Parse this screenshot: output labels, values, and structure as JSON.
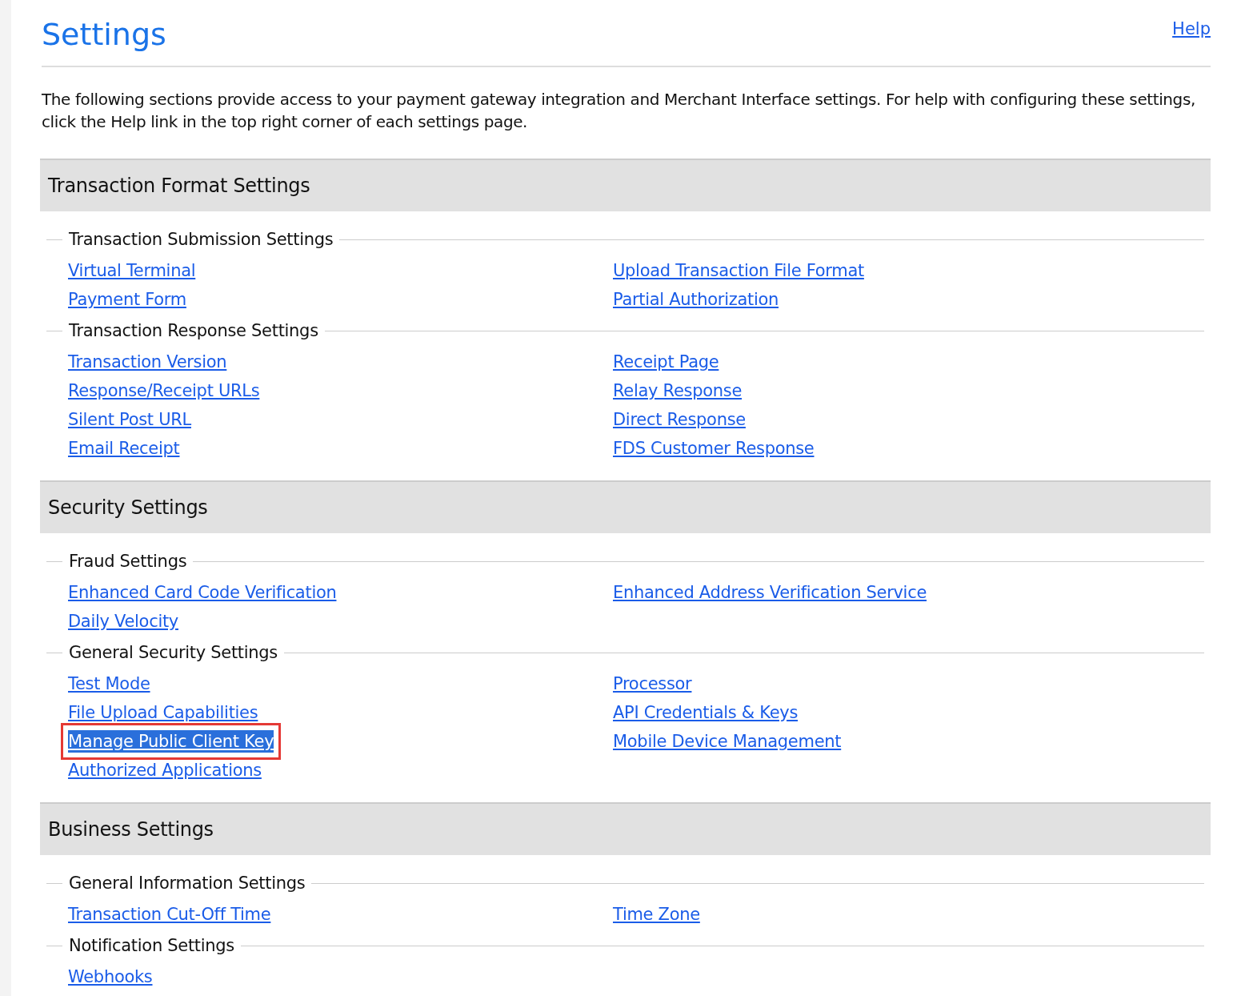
{
  "title": "Settings",
  "help_link": "Help",
  "intro": "The following sections provide access to your payment gateway integration and Merchant Interface settings. For help with configuring these settings, click the Help link in the top right corner of each settings page.",
  "sections": [
    {
      "title": "Transaction Format Settings",
      "groups": [
        {
          "title": "Transaction Submission Settings",
          "left": [
            {
              "label": "Virtual Terminal",
              "selected": false
            },
            {
              "label": "Payment Form",
              "selected": false
            }
          ],
          "right": [
            {
              "label": "Upload Transaction File Format",
              "selected": false
            },
            {
              "label": "Partial Authorization",
              "selected": false
            }
          ]
        },
        {
          "title": "Transaction Response Settings",
          "left": [
            {
              "label": "Transaction Version",
              "selected": false
            },
            {
              "label": "Response/Receipt URLs",
              "selected": false
            },
            {
              "label": "Silent Post URL",
              "selected": false
            },
            {
              "label": "Email Receipt",
              "selected": false
            }
          ],
          "right": [
            {
              "label": "Receipt Page",
              "selected": false
            },
            {
              "label": "Relay Response",
              "selected": false
            },
            {
              "label": "Direct Response",
              "selected": false
            },
            {
              "label": "FDS Customer Response",
              "selected": false
            }
          ]
        }
      ]
    },
    {
      "title": "Security Settings",
      "groups": [
        {
          "title": "Fraud Settings",
          "left": [
            {
              "label": "Enhanced Card Code Verification",
              "selected": false
            },
            {
              "label": "Daily Velocity",
              "selected": false
            }
          ],
          "right": [
            {
              "label": "Enhanced Address Verification Service",
              "selected": false
            }
          ]
        },
        {
          "title": "General Security Settings",
          "left": [
            {
              "label": "Test Mode",
              "selected": false
            },
            {
              "label": "File Upload Capabilities",
              "selected": false
            },
            {
              "label": "Manage Public Client Key",
              "selected": true
            },
            {
              "label": "Authorized Applications",
              "selected": false
            }
          ],
          "right": [
            {
              "label": "Processor",
              "selected": false
            },
            {
              "label": "API Credentials & Keys",
              "selected": false
            },
            {
              "label": "Mobile Device Management",
              "selected": false
            }
          ]
        }
      ]
    },
    {
      "title": "Business Settings",
      "groups": [
        {
          "title": "General Information Settings",
          "left": [
            {
              "label": "Transaction Cut-Off Time",
              "selected": false
            }
          ],
          "right": [
            {
              "label": "Time Zone",
              "selected": false
            }
          ]
        },
        {
          "title": "Notification Settings",
          "left": [
            {
              "label": "Webhooks",
              "selected": false
            }
          ]
        }
      ]
    }
  ]
}
